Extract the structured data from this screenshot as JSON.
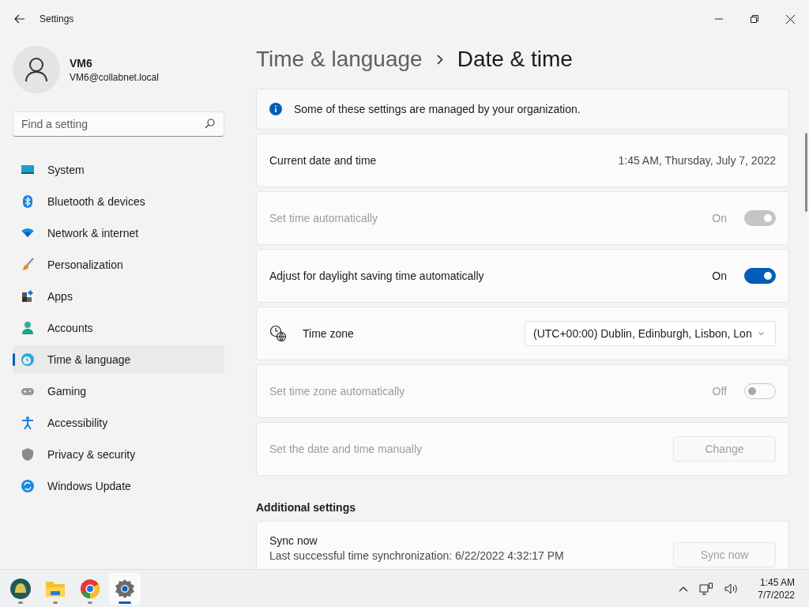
{
  "window": {
    "title": "Settings"
  },
  "user": {
    "name": "VM6",
    "email": "VM6@collabnet.local"
  },
  "search": {
    "placeholder": "Find a setting"
  },
  "nav": [
    {
      "label": "System",
      "kind": "system",
      "selected": false
    },
    {
      "label": "Bluetooth & devices",
      "kind": "bluetooth",
      "selected": false
    },
    {
      "label": "Network & internet",
      "kind": "network",
      "selected": false
    },
    {
      "label": "Personalization",
      "kind": "brush",
      "selected": false
    },
    {
      "label": "Apps",
      "kind": "apps",
      "selected": false
    },
    {
      "label": "Accounts",
      "kind": "accounts",
      "selected": false
    },
    {
      "label": "Time & language",
      "kind": "time",
      "selected": true
    },
    {
      "label": "Gaming",
      "kind": "gaming",
      "selected": false
    },
    {
      "label": "Accessibility",
      "kind": "accessibility",
      "selected": false
    },
    {
      "label": "Privacy & security",
      "kind": "privacy",
      "selected": false
    },
    {
      "label": "Windows Update",
      "kind": "update",
      "selected": false
    }
  ],
  "breadcrumb": {
    "parent": "Time & language",
    "current": "Date & time"
  },
  "notice": "Some of these settings are managed by your organization.",
  "rows": [
    {
      "kind": "value",
      "label": "Current date and time",
      "value": "1:45 AM, Thursday, July 7, 2022",
      "disabled": false
    },
    {
      "kind": "toggle",
      "label": "Set time automatically",
      "state_label": "On",
      "on": true,
      "disabled": true
    },
    {
      "kind": "toggle",
      "label": "Adjust for daylight saving time automatically",
      "state_label": "On",
      "on": true,
      "disabled": false
    },
    {
      "kind": "select",
      "label": "Time zone",
      "value": "(UTC+00:00) Dublin, Edinburgh, Lisbon, Lon",
      "disabled": false
    },
    {
      "kind": "toggle",
      "label": "Set time zone automatically",
      "state_label": "Off",
      "on": false,
      "disabled": true
    },
    {
      "kind": "button",
      "label": "Set the date and time manually",
      "button": "Change",
      "disabled": true
    }
  ],
  "additional": {
    "heading": "Additional settings",
    "sync": {
      "title": "Sync now",
      "detail": "Last successful time synchronization: 6/22/2022 4:32:17 PM",
      "button": "Sync now",
      "disabled": true
    }
  },
  "taskbar": {
    "apps": [
      {
        "kind": "shell",
        "selected": false
      },
      {
        "kind": "folder",
        "selected": false
      },
      {
        "kind": "browser",
        "selected": false
      },
      {
        "kind": "settings",
        "selected": true
      }
    ],
    "clock": {
      "time": "1:45 AM",
      "date": "7/7/2022"
    }
  }
}
